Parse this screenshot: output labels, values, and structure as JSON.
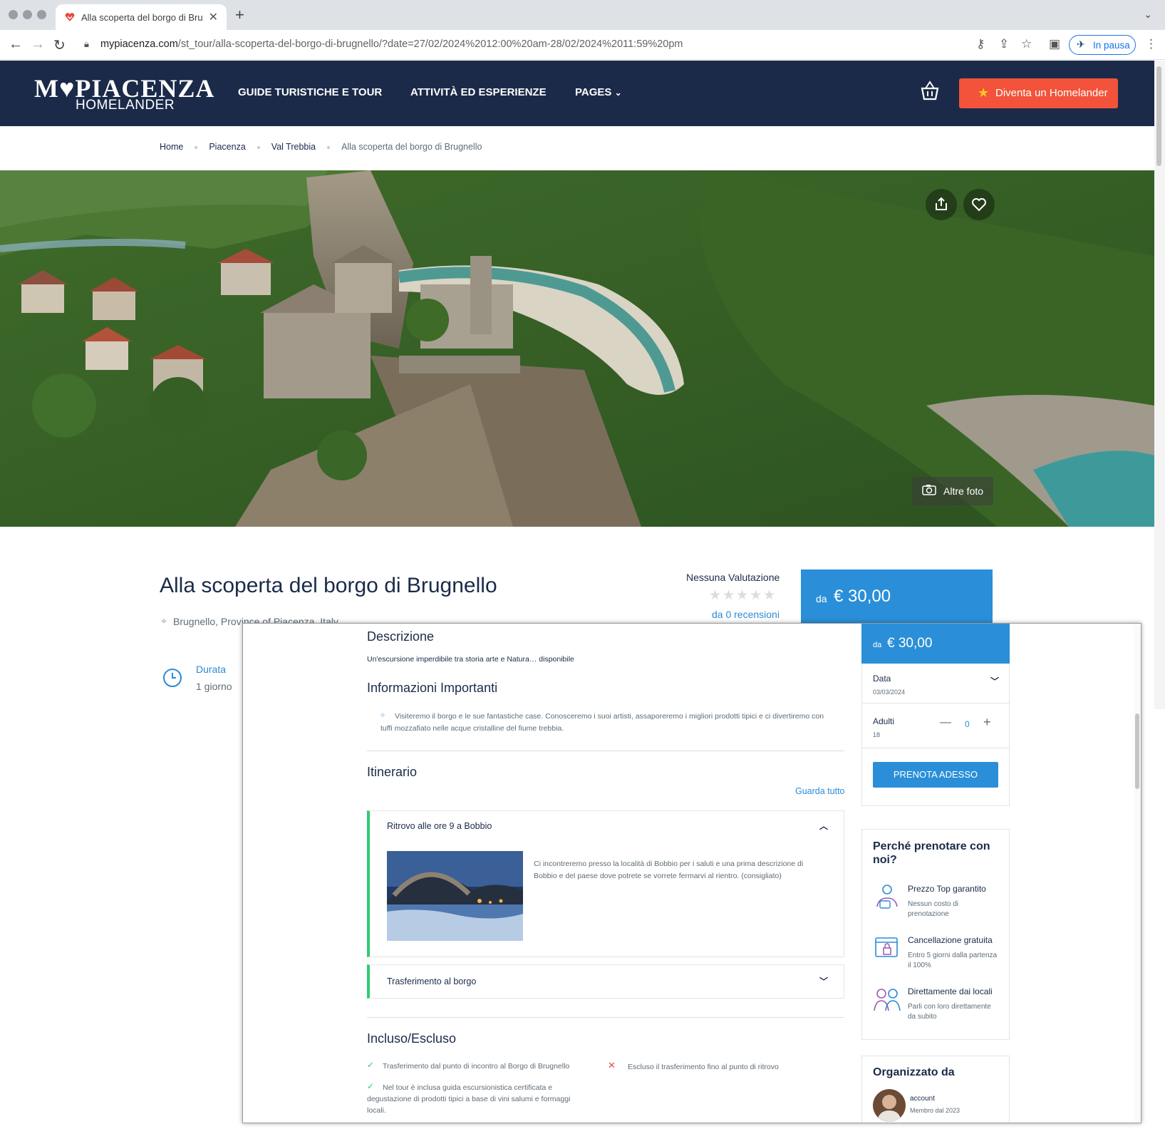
{
  "browser": {
    "tab_title": "Alla scoperta del borgo di Brug",
    "url_host": "mypiacenza.com",
    "url_path": "/st_tour/alla-scoperta-del-borgo-di-brugnello/?date=27/02/2024%2012:00%20am-28/02/2024%2011:59%20pm",
    "profile_status": "In pausa"
  },
  "header": {
    "logo_main": "M♥PIACENZA",
    "logo_sub": "HOMELANDER",
    "nav": [
      "GUIDE TURISTICHE E TOUR",
      "ATTIVITÀ ED ESPERIENZE",
      "PAGES"
    ],
    "cta": "Diventa un Homelander"
  },
  "breadcrumb": [
    "Home",
    "Piacenza",
    "Val Trebbia",
    "Alla scoperta del borgo di Brugnello"
  ],
  "hero": {
    "more_photos": "Altre foto"
  },
  "tour": {
    "title": "Alla scoperta del borgo di Brugnello",
    "location": "Brugnello, Province of Piacenza, Italy",
    "rating_label": "Nessuna Valutazione",
    "stars": "★★★★★",
    "reviews": "da 0 recensioni",
    "price_prefix": "da",
    "price": "€ 30,00",
    "duration_label": "Durata",
    "duration_value": "1 giorno"
  },
  "detail": {
    "desc_heading": "Descrizione",
    "desc_text": "Un'escursione imperdibile tra storia arte e Natura… disponibile",
    "info_heading": "Informazioni Importanti",
    "info_text": "Visiteremo il borgo e le sue fantastiche case. Conosceremo i suoi artisti, assaporeremo i migliori prodotti tipici e ci divertiremo con tuffi mozzafiato nelle acque cristalline del fiume trebbia.",
    "itin_heading": "Itinerario",
    "see_all": "Guarda tutto",
    "itinerary": [
      {
        "title": "Ritrovo alle ore 9 a Bobbio",
        "text": "Ci incontreremo presso la località di Bobbio per i saluti e una prima descrizione di Bobbio e del paese dove potrete se vorrete fermarvi al rientro. (consigliato)"
      },
      {
        "title": "Trasferimento al borgo",
        "text": ""
      }
    ],
    "incl_heading": "Incluso/Escluso",
    "included": [
      "Trasferimento dal punto di incontro al Borgo di Brugnello",
      "Nel tour è inclusa guida escursionistica certificata e degustazione di prodotti tipici a base di vini salumi e formaggi locali."
    ],
    "excluded": [
      "Escluso il trasferimento fino al punto di ritrovo"
    ]
  },
  "booking": {
    "price_prefix": "da",
    "price": "€ 30,00",
    "date_label": "Data",
    "date_value": "03/03/2024",
    "adults_label": "Adulti",
    "adults_sub": "18",
    "adults_count": "0",
    "book_button": "PRENOTA ADESSO"
  },
  "why": {
    "title": "Perché prenotare con noi?",
    "items": [
      {
        "title": "Prezzo Top garantito",
        "text": "Nessun costo di prenotazione"
      },
      {
        "title": "Cancellazione gratuita",
        "text": "Entro 5 giorni dalla partenza il 100%"
      },
      {
        "title": "Direttamente dai locali",
        "text": "Parli con loro direttamente da subito"
      }
    ]
  },
  "organizer": {
    "title": "Organizzato da",
    "name": "account",
    "member_since": "Membro dal 2023"
  },
  "colors": {
    "header_bg": "#1b2a49",
    "accent_blue": "#2a8fd8",
    "cta_orange": "#f2533a",
    "itinerary_green": "#2ecc71"
  }
}
